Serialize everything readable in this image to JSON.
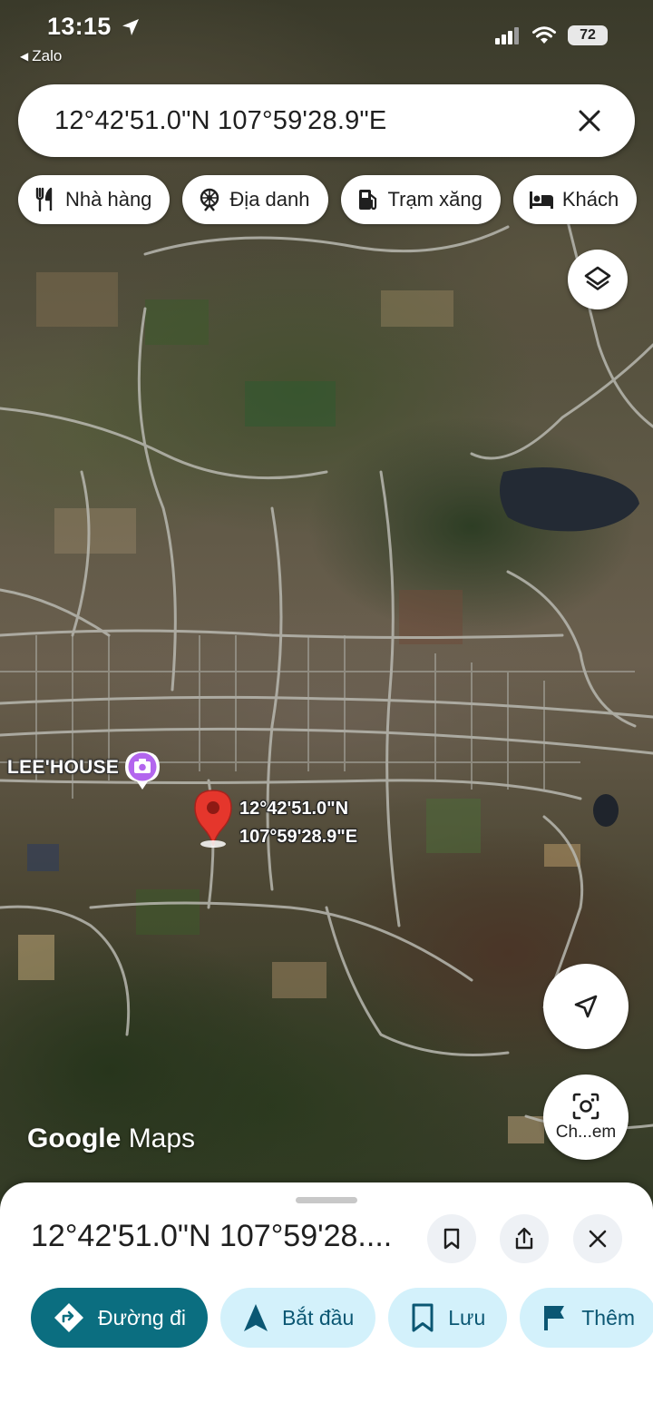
{
  "status_bar": {
    "time": "13:15",
    "back_app": "Zalo",
    "battery": "72"
  },
  "search": {
    "query": "12°42'51.0\"N 107°59'28.9\"E"
  },
  "categories": [
    {
      "label": "Nhà hàng",
      "icon": "restaurant-icon"
    },
    {
      "label": "Địa danh",
      "icon": "landmark-icon"
    },
    {
      "label": "Trạm xăng",
      "icon": "gas-station-icon"
    },
    {
      "label": "Khách",
      "icon": "hotel-icon"
    }
  ],
  "map": {
    "place_label": "LEE'HOUSE",
    "pin_lat": "12°42'51.0\"N",
    "pin_lng": "107°59'28.9\"E",
    "watermark_google": "Google",
    "watermark_maps": "Maps",
    "lens_label": "Ch...em"
  },
  "sheet": {
    "title": "12°42'51.0\"N 107°59'28....",
    "actions": [
      {
        "label": "Đường đi",
        "icon": "directions-icon"
      },
      {
        "label": "Bắt đầu",
        "icon": "navigation-icon"
      },
      {
        "label": "Lưu",
        "icon": "bookmark-icon"
      },
      {
        "label": "Thêm",
        "icon": "flag-icon"
      }
    ]
  },
  "colors": {
    "primary_action": "#0b6e80",
    "secondary_action": "#d3f1fb",
    "pin": "#e5362c"
  }
}
